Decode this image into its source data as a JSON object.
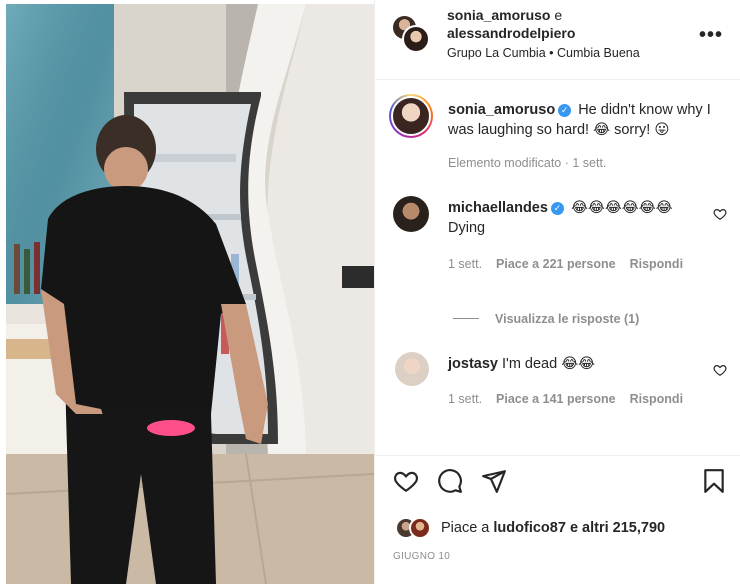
{
  "header": {
    "user1": "sonia_amoruso",
    "conjunction": "e",
    "user2": "alessandrodelpiero",
    "audio": "Grupo La Cumbia • Cumbia Buena",
    "more_icon": "more-horizontal-icon"
  },
  "caption": {
    "username": "sonia_amoruso",
    "text": "He didn't know why I was laughing so hard! 😂 sorry! 😛",
    "meta": "Elemento modificato · 1 sett."
  },
  "comments": [
    {
      "username": "michaellandes",
      "verified": true,
      "inline_text": "😂😂😂😂😂😂",
      "text": "Dying",
      "time": "1 sett.",
      "likes": "Piace a 221 persone",
      "reply": "Rispondi"
    },
    {
      "username": "jostasy",
      "verified": false,
      "text": "I'm dead 😂😂",
      "time": "1 sett.",
      "likes": "Piace a 141 persone",
      "reply": "Rispondi"
    }
  ],
  "view_replies": "Visualizza le risposte (1)",
  "actions": {
    "like_icon": "heart-icon",
    "comment_icon": "comment-icon",
    "share_icon": "send-icon",
    "save_icon": "bookmark-icon"
  },
  "likes": {
    "prefix": "Piace a ",
    "user": "ludofico87",
    "suffix": " e altri 215,790"
  },
  "date": "GIUGNO 10"
}
